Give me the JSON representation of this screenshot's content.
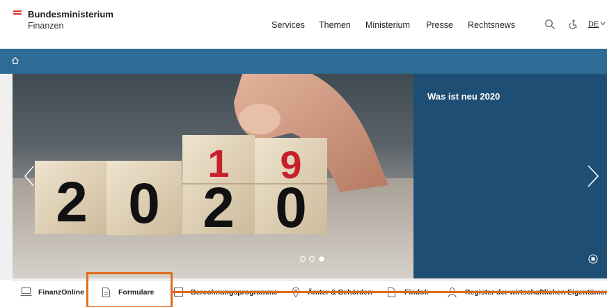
{
  "logo": {
    "line1": "Bundesministerium",
    "line2": "Finanzen"
  },
  "nav": [
    "Services",
    "Themen",
    "Ministerium",
    "Presse",
    "Rechtsnews"
  ],
  "header_icons": [
    "search-icon",
    "accessibility-icon"
  ],
  "language": "DE",
  "breadcrumb": {
    "icon": "home-icon"
  },
  "hero": {
    "photo_text": {
      "year_old": "19",
      "year_new": "2020"
    },
    "panel_title": "Was ist neu 2020",
    "slides_total": 3,
    "active_slide": 3
  },
  "quick_links": [
    {
      "label": "FinanzOnline",
      "icon": "laptop-icon"
    },
    {
      "label": "Formulare",
      "icon": "document-icon"
    },
    {
      "label": "Berechnungsprogramme",
      "icon": "calculator-icon"
    },
    {
      "label": "Ämter & Behörden",
      "icon": "location-icon"
    },
    {
      "label": "Findok",
      "icon": "file-icon"
    },
    {
      "label": "Register der wirtschaftlichen Eigentümer",
      "icon": "user-icon"
    }
  ],
  "colors": {
    "blue_bar": "#2e6b95",
    "panel": "#1f4e75",
    "logo_red": "#e6332a",
    "highlight": "#e06a1b"
  }
}
